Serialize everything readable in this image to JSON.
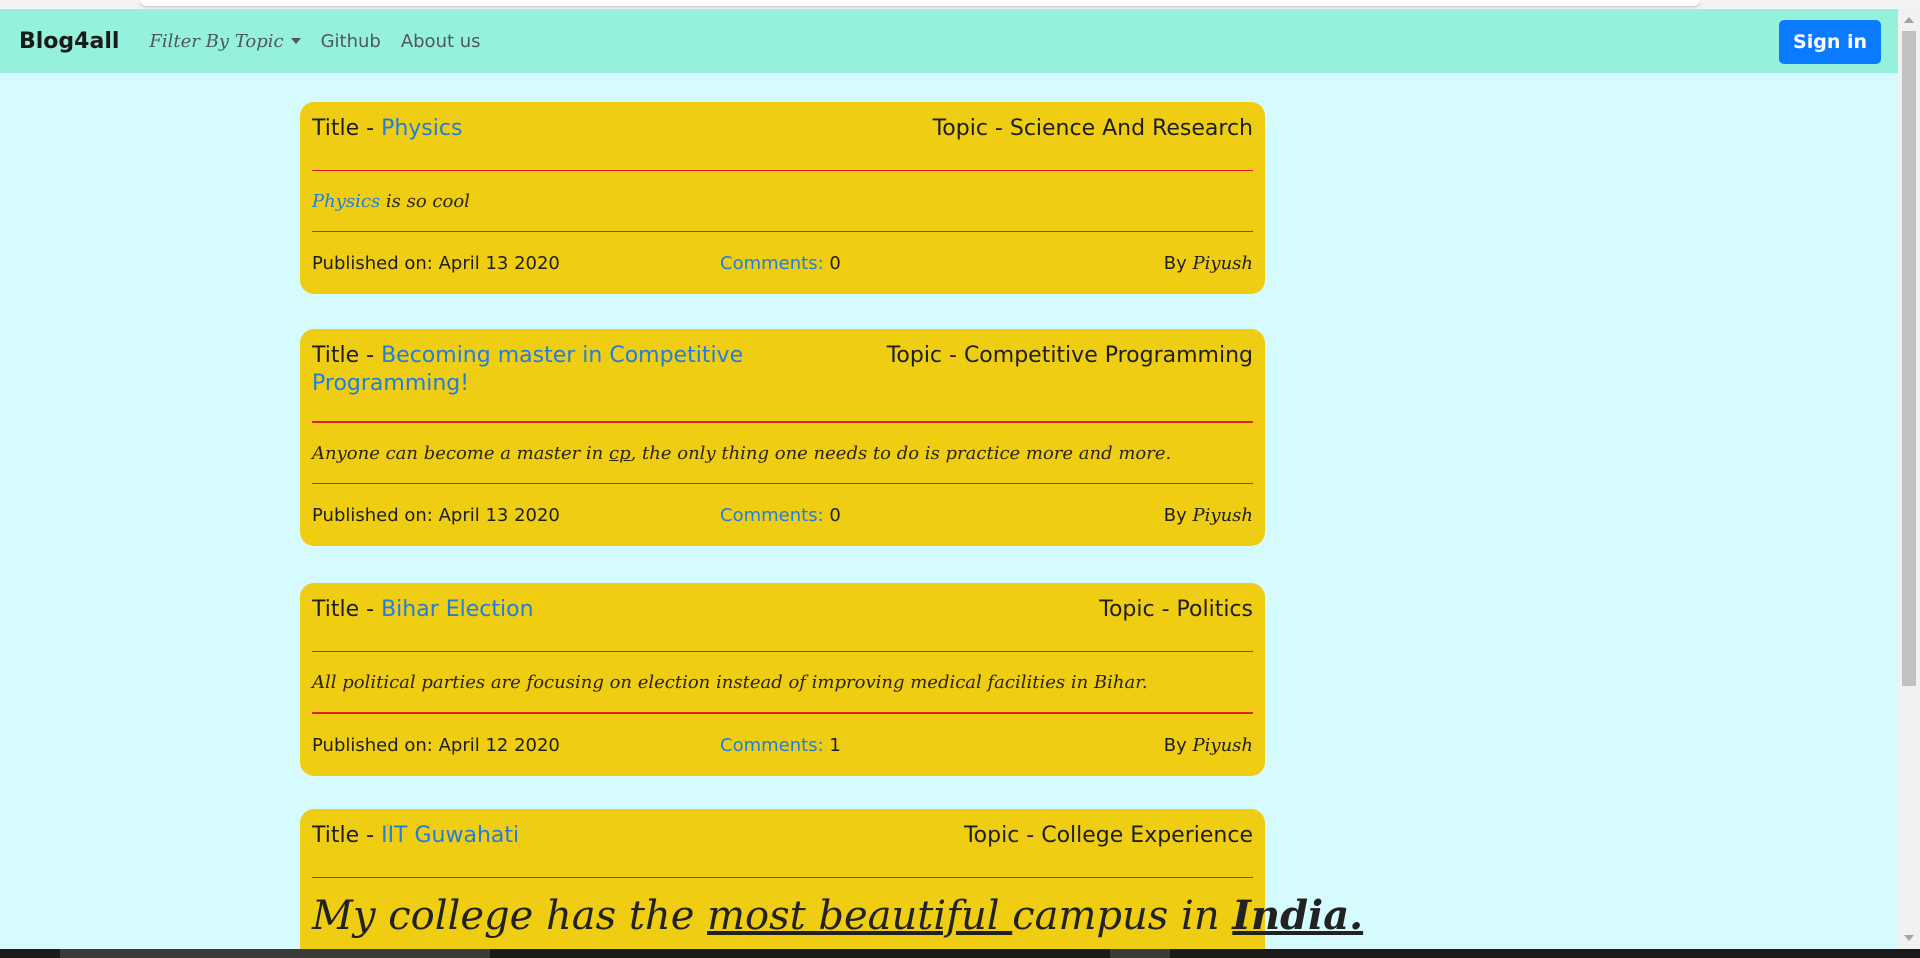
{
  "navbar": {
    "brand": "Blog4all",
    "filter_label": "Filter By Topic",
    "github_label": "Github",
    "about_label": "About us",
    "signin_label": "Sign in"
  },
  "posts": [
    {
      "title_prefix": "Title - ",
      "title": "Physics",
      "topic": "Topic - Science And Research",
      "body_link": "Physics",
      "body_rest": " is so cool",
      "published": "Published on: April 13 2020",
      "comments_label": "Comments:",
      "comments_count": "0",
      "by_label": "By ",
      "author": "Piyush"
    },
    {
      "title_prefix": "Title - ",
      "title": "Becoming master in Competitive Programming!",
      "topic": "Topic - Competitive Programming",
      "body_before": "Anyone can become a master in ",
      "body_underlined": "cp",
      "body_after": ", the only thing one needs to do is practice more and more.",
      "published": "Published on: April 13 2020",
      "comments_label": "Comments:",
      "comments_count": "0",
      "by_label": "By ",
      "author": "Piyush"
    },
    {
      "title_prefix": "Title - ",
      "title": "Bihar Election",
      "topic": "Topic - Politics",
      "body": "All political parties are focusing on election instead of improving medical facilities in Bihar.",
      "published": "Published on: April 12 2020",
      "comments_label": "Comments:",
      "comments_count": "1",
      "by_label": "By ",
      "author": "Piyush"
    },
    {
      "title_prefix": "Title - ",
      "title": "IIT Guwahati",
      "topic": "Topic - College Experience",
      "body_a": "My college has the ",
      "body_b": "most beautiful ",
      "body_c": "campus in ",
      "body_d": "India."
    }
  ],
  "colors": {
    "page_bg": "#d5fbff",
    "navbar_bg": "#96f1dc",
    "card_bg": "#efcd12",
    "link": "#1f7ee0",
    "rule": "#e0201d",
    "signin_bg": "#0a7bff"
  }
}
